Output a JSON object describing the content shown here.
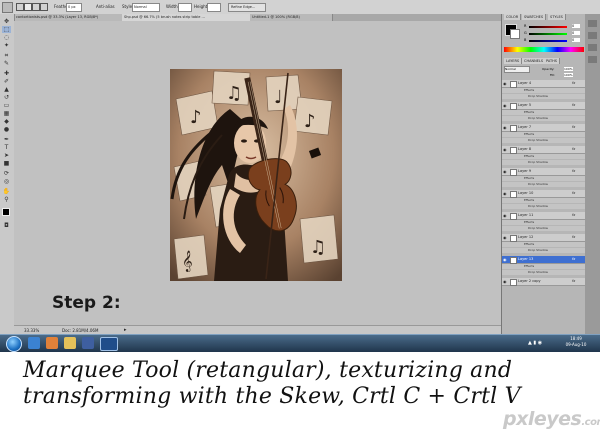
{
  "options_bar": {
    "feather_label": "Feather:",
    "feather_value": "0 px",
    "antialias_label": "Anti-alias",
    "style_label": "Style:",
    "style_value": "Normal",
    "width_label": "Width:",
    "height_label": "Height:",
    "refine_edge": "Refine Edge..."
  },
  "document_tabs": [
    "contortionists.psd @ 33.3% (Layer 13, RGB/8*)",
    "Shp.psd @ 66.7% (5 brush notes strip table ...",
    "Untitled-1 @ 100% (RGB/8)"
  ],
  "canvas": {
    "step_text": "Step 2:",
    "zoom": "33.33%",
    "doc_size": "Doc: 2.81M/4.06M"
  },
  "panels": {
    "top_tabs": [
      "COLOR",
      "SWATCHES",
      "STYLES"
    ],
    "rgb_labels": [
      "R",
      "G",
      "B"
    ],
    "rgb_values": [
      "0",
      "0",
      "0"
    ],
    "layers_tabs": [
      "LAYERS",
      "CHANNELS",
      "PATHS"
    ],
    "blend_mode": "Normal",
    "opacity_label": "Opacity:",
    "opacity_value": "100%",
    "fill_label": "Fill:",
    "fill_value": "100%",
    "effects_label": "Effects",
    "drop_shadow_label": "Drop Shadow",
    "layers": [
      "Layer 4",
      "Layer 5",
      "Layer 7",
      "Layer 8",
      "Layer 9",
      "Layer 10",
      "Layer 11",
      "Layer 12",
      "Layer 13",
      "Layer 2 copy"
    ],
    "selected_layer": "Layer 13"
  },
  "taskbar": {
    "time": "18:49",
    "date": "09-Aug-10"
  },
  "caption": {
    "line1": "Marquee Tool (retangular), texturizing and",
    "line2": "transforming with the Skew, Crtl C + Crtl V"
  },
  "watermark": {
    "main": "pxleyes",
    "suffix": ".com"
  },
  "colors": {
    "selection": "#3e6fd1",
    "taskbar": "#1d3248",
    "photo_sepia": "#c8a88a"
  }
}
